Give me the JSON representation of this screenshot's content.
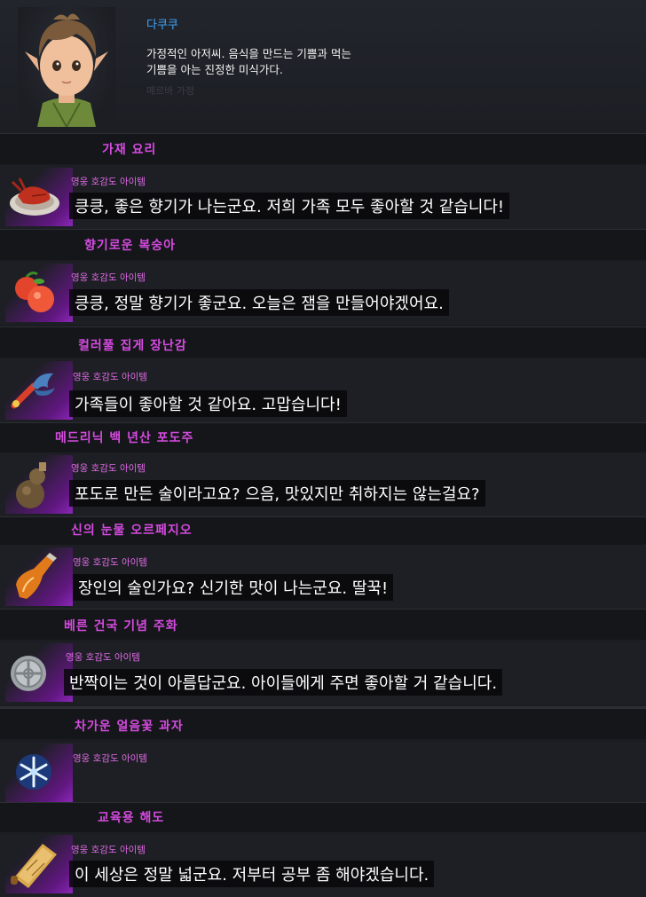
{
  "npc": {
    "name": "다쿠쿠",
    "description": "가정적인 아저씨. 음식을 만드는 기쁨과 먹는\n기쁨을 아는 진정한 미식가다.",
    "faded_text": "메르바 가정"
  },
  "favor_label": "영웅 호감도 아이템",
  "items": [
    {
      "title": "가재 요리",
      "dialogue": "킁킁, 좋은 향기가 나는군요. 저희 가족 모두 좋아할 것 같습니다!",
      "icon": "crayfish-dish-icon"
    },
    {
      "title": "향기로운 복숭아",
      "dialogue": "킁킁, 정말 향기가 좋군요. 오늘은 잼을 만들어야겠어요.",
      "icon": "peach-icon"
    },
    {
      "title": "컬러풀 집게 장난감",
      "dialogue": "가족들이 좋아할 것 같아요. 고맙습니다!",
      "icon": "claw-toy-icon"
    },
    {
      "title": "메드리닉 백 년산 포도주",
      "dialogue": "포도로 만든 술이라고요? 으음, 맛있지만 취하지는 않는걸요?",
      "icon": "wine-gourd-icon"
    },
    {
      "title": "신의 눈물 오르페지오",
      "dialogue": "장인의 술인가요? 신기한 맛이 나는군요. 딸꾹!",
      "icon": "liquor-bottle-icon"
    },
    {
      "title": "베른 건국 기념 주화",
      "dialogue": "반짝이는 것이 아름답군요. 아이들에게 주면 좋아할 거 같습니다.",
      "icon": "silver-coin-icon"
    },
    {
      "title": "차가운 얼음꽃 과자",
      "dialogue": "",
      "icon": "snowflake-cookie-icon"
    },
    {
      "title": "교육용 해도",
      "dialogue": "이 세상은 정말 넓군요. 저부터 공부 좀 해야겠습니다.",
      "icon": "sea-chart-icon"
    }
  ]
}
